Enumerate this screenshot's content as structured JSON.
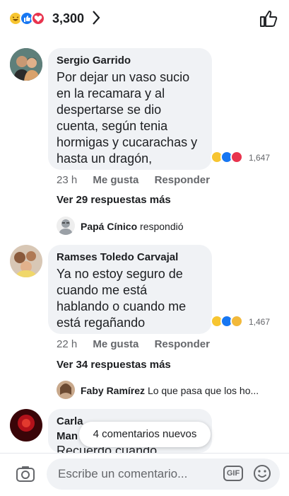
{
  "header": {
    "reaction_count": "3,300",
    "reactions": [
      "haha-icon",
      "like-icon",
      "love-icon"
    ]
  },
  "comments": [
    {
      "author": "Sergio Garrido",
      "text": "Por dejar un vaso sucio\nen la recamara y al\ndespertarse se dio\ncuenta, según tenia\nhormigas y cucarachas y\nhasta un dragón,",
      "reaction_count": "1,647",
      "time": "23 h",
      "like_label": "Me gusta",
      "reply_label": "Responder",
      "more_replies": "Ver 29 respuestas más",
      "last_reply": {
        "author": "Papá Cínico",
        "snippet": "respondió"
      }
    },
    {
      "author": "Ramses Toledo Carvajal",
      "text": "Ya no estoy seguro de\ncuando me está\nhablando o cuando me\nestá regañando",
      "reaction_count": "1,467",
      "time": "22 h",
      "like_label": "Me gusta",
      "reply_label": "Responder",
      "more_replies": "Ver 34 respuestas más",
      "last_reply": {
        "author": "Faby Ramírez",
        "snippet": "Lo que pasa que los ho..."
      }
    },
    {
      "author": "Carla Daniela Gallardo Man",
      "author_visible_line1": "Carla",
      "author_visible_line2": "Man",
      "text": "Recuerdo cuando"
    }
  ],
  "new_comments_pill": "4 comentarios nuevos",
  "composer": {
    "placeholder": "Escribe un comentario...",
    "gif_label": "GIF"
  },
  "colors": {
    "like_blue": "#1877f2",
    "love_red": "#e8344e",
    "haha_yellow": "#f7c531",
    "bubble": "#f0f2f5",
    "muted": "#65676b"
  }
}
